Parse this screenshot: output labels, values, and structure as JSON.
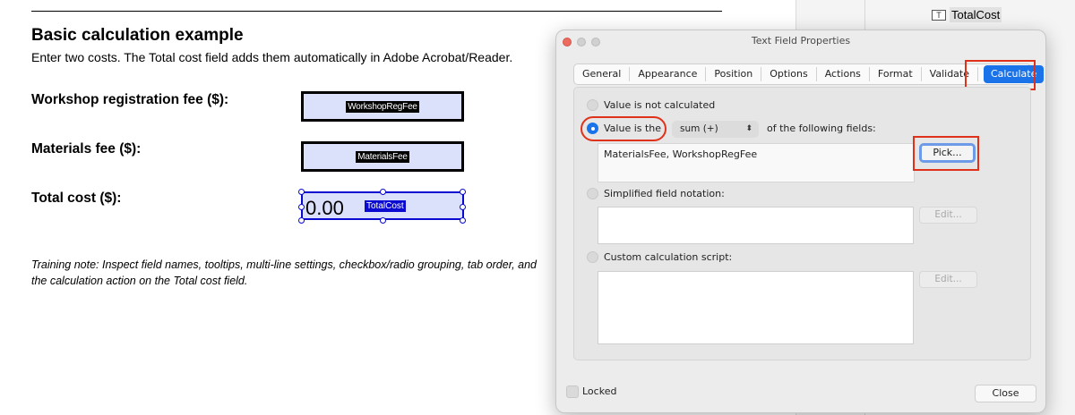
{
  "document": {
    "title": "Basic calculation example",
    "subtitle": "Enter two costs. The Total cost field adds them automatically in Adobe Acrobat/Reader.",
    "fields": [
      {
        "label": "Workshop registration fee ($):",
        "name": "WorkshopRegFee"
      },
      {
        "label": "Materials fee ($):",
        "name": "MaterialsFee"
      },
      {
        "label": "Total cost ($):",
        "name": "TotalCost",
        "value": "0.00"
      }
    ],
    "training_note": "Training note: Inspect field names, tooltips, multi-line settings, checkbox/radio grouping, tab order, and the calculation action on the Total cost field."
  },
  "side_panel": {
    "tree_item": "TotalCost",
    "tree_icon": "text-field-icon"
  },
  "dialog": {
    "title": "Text Field Properties",
    "tabs": [
      "General",
      "Appearance",
      "Position",
      "Options",
      "Actions",
      "Format",
      "Validate",
      "Calculate"
    ],
    "active_tab": "Calculate",
    "options": {
      "not_calculated": "Value is not calculated",
      "value_is_the": "Value is the",
      "operation": "sum (+)",
      "of_following": "of the following fields:",
      "fields_list": "MaterialsFee, WorkshopRegFee",
      "pick": "Pick...",
      "simplified": "Simplified field notation:",
      "simplified_edit": "Edit...",
      "custom": "Custom calculation script:",
      "custom_edit": "Edit..."
    },
    "locked_label": "Locked",
    "close_label": "Close",
    "accent_color": "#1a73e8",
    "highlight_color": "#e0321a"
  }
}
